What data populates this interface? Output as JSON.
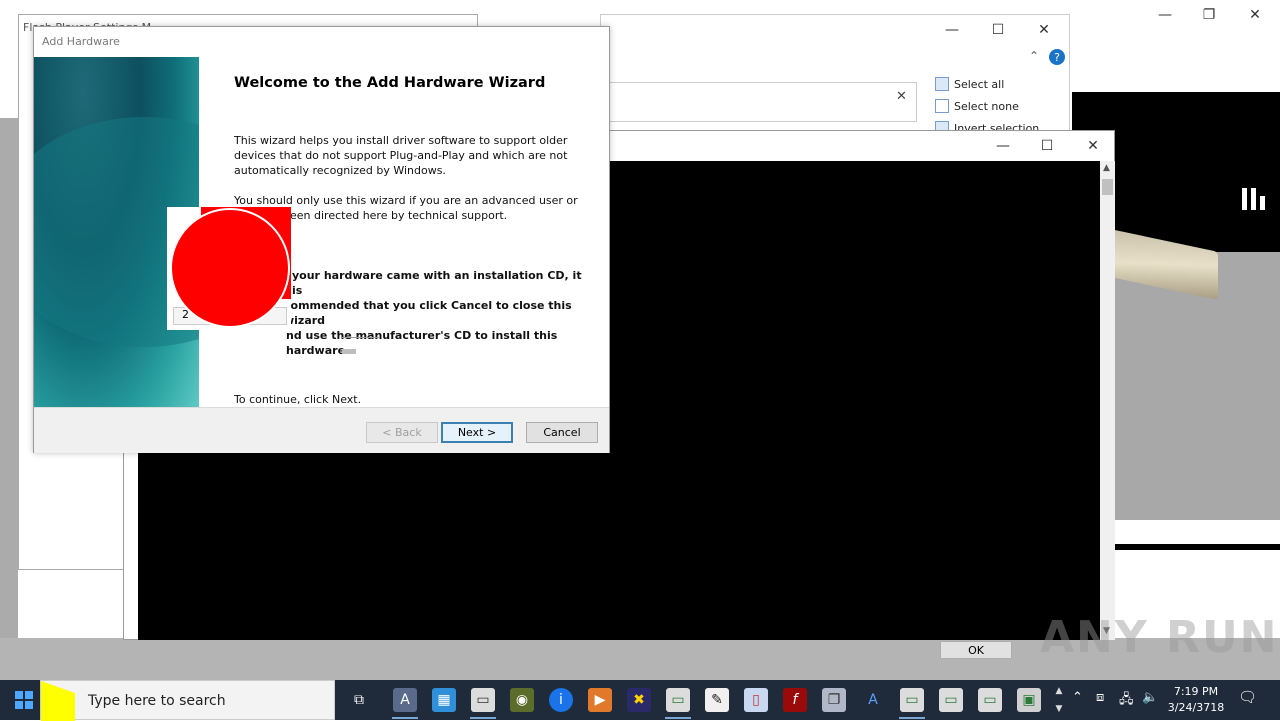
{
  "wizard": {
    "window_title": "Add Hardware",
    "heading": "Welcome to the Add Hardware Wizard",
    "para1_line1": "This wizard helps you install driver software to support older",
    "para1_line2": "devices that do not support Plug-and-Play and which are not",
    "para1_line3": "automatically recognized by Windows.",
    "para2_line1": "You should only use this wizard if you are an advanced user or",
    "para2_line2": "een directed here by technical support.",
    "para3_line1": "your hardware came with an installation CD, it is",
    "para3_line2": "commended that you click Cancel to close this wizard",
    "para3_line3": "nd use the manufacturer's CD to install this hardware.",
    "continue_text": "To continue, click Next.",
    "back_label": "< Back",
    "next_label": "Next >",
    "cancel_label": "Cancel",
    "small_field_text": "2"
  },
  "background": {
    "flash_window_title": "Flash Player Settings M",
    "ribbon": {
      "select_all": "Select all",
      "select_none": "Select none",
      "invert_selection": "Invert selection"
    },
    "ok_label": "OK",
    "watermark": "ANY RUN"
  },
  "taskbar": {
    "search_placeholder": "Type here to search",
    "time": "7:19 PM",
    "date": "3/24/3718"
  },
  "colors": {
    "red_circle": "#ff0000",
    "taskbar": "#1f2a3a",
    "accent": "#0078d7"
  }
}
